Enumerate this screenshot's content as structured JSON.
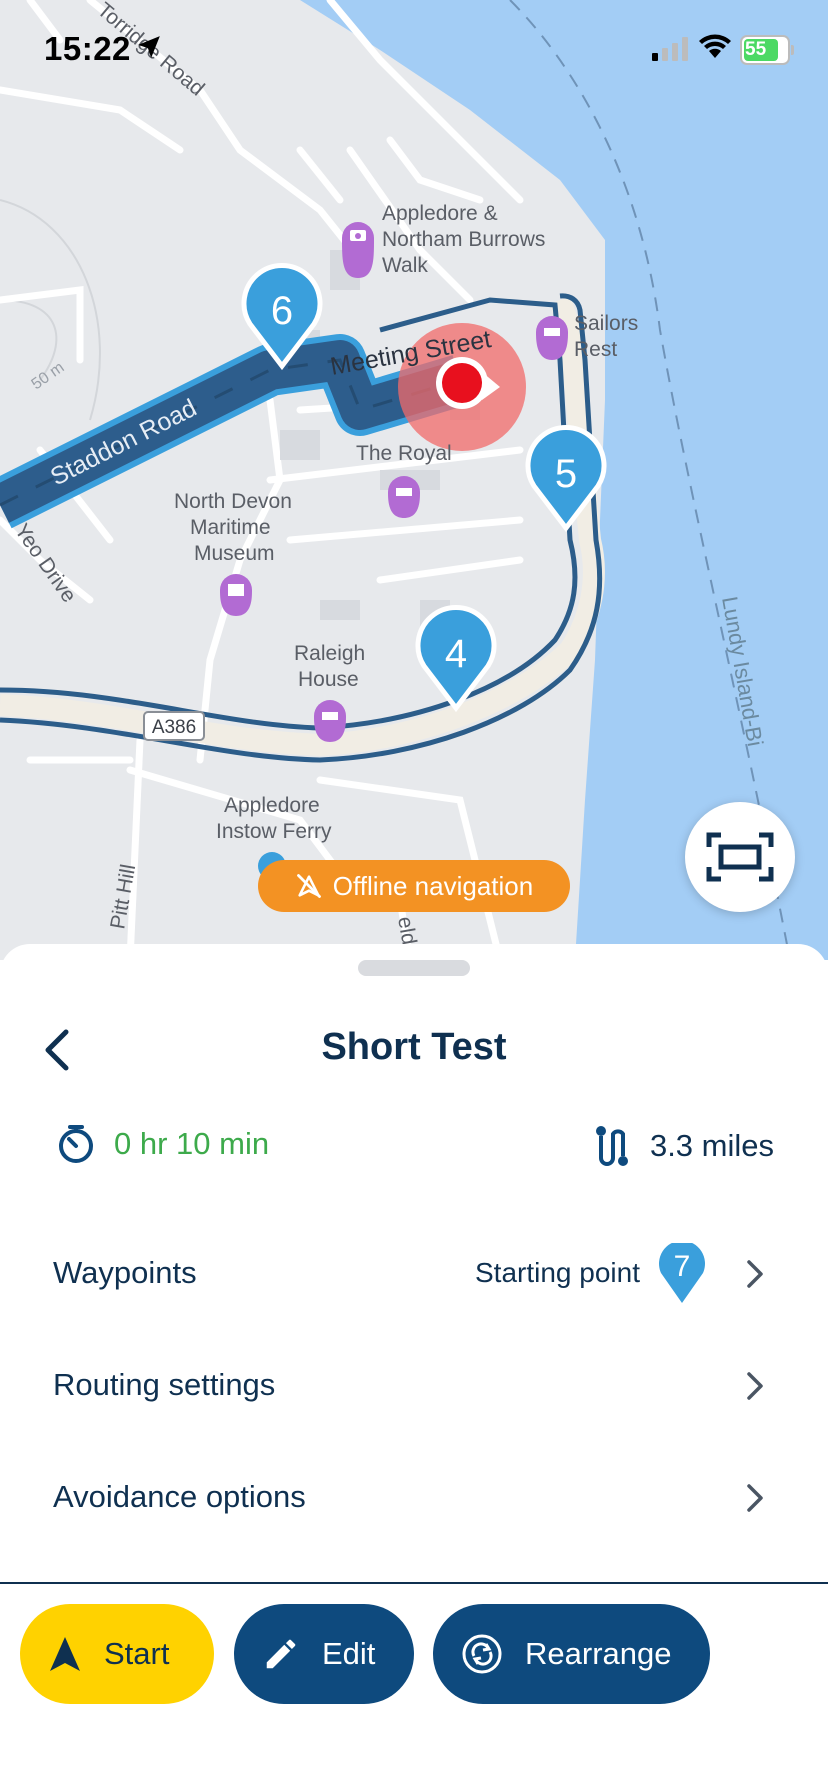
{
  "status_bar": {
    "time": "15:22",
    "battery": "55"
  },
  "map": {
    "labels": {
      "torridge_road": "Torridge Road",
      "appledore_walk_1": "Appledore &",
      "appledore_walk_2": "Northam Burrows",
      "appledore_walk_3": "Walk",
      "sailors_1": "Sailors",
      "sailors_2": "Rest",
      "meeting_street": "Meeting Street",
      "staddon_road": "Staddon Road",
      "the_royal": "The Royal",
      "museum_1": "North Devon",
      "museum_2": "Maritime",
      "museum_3": "Museum",
      "yeo_drive": "Yeo Drive",
      "raleigh_1": "Raleigh",
      "raleigh_2": "House",
      "a386": "A386",
      "ferry_1": "Appledore",
      "ferry_2": "Instow Ferry",
      "pitt_hill": "Pitt Hill",
      "field": "eld",
      "contour": "50 m",
      "lundy": "Lundy Island-Bi"
    },
    "waypoints": [
      "6",
      "5",
      "4"
    ],
    "offline_label": "Offline navigation"
  },
  "sheet": {
    "title": "Short Test",
    "duration": "0 hr 10 min",
    "distance": "3.3 miles",
    "rows": [
      {
        "label": "Waypoints",
        "value": "Starting point",
        "badge": "7"
      },
      {
        "label": "Routing settings"
      },
      {
        "label": "Avoidance options"
      }
    ]
  },
  "actions": {
    "start": "Start",
    "edit": "Edit",
    "rearrange": "Rearrange"
  },
  "colors": {
    "accent": "#0e4a7e",
    "start": "#ffd200",
    "pin": "#3a9fdc",
    "offline": "#f39223",
    "time_green": "#3daa4b"
  }
}
